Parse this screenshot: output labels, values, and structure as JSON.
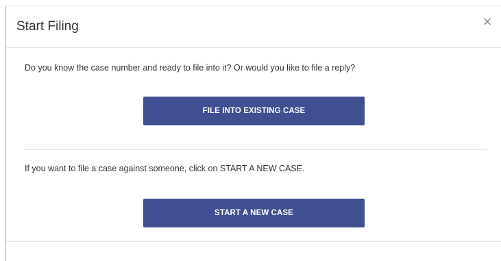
{
  "dialog": {
    "title": "Start Filing",
    "close_label": "×"
  },
  "body": {
    "existing_prompt": "Do you know the case number and ready to file into it? Or would you like to file a reply?",
    "existing_button_label": "FILE INTO EXISTING CASE",
    "new_prompt": "If you want to file a case against someone, click on START A NEW CASE.",
    "new_button_label": "START A NEW CASE"
  },
  "colors": {
    "button_bg": "#3f4f8f",
    "button_text": "#ffffff",
    "text": "#333333",
    "divider": "#e3e3e3"
  },
  "icons": {
    "close": "close-icon"
  }
}
